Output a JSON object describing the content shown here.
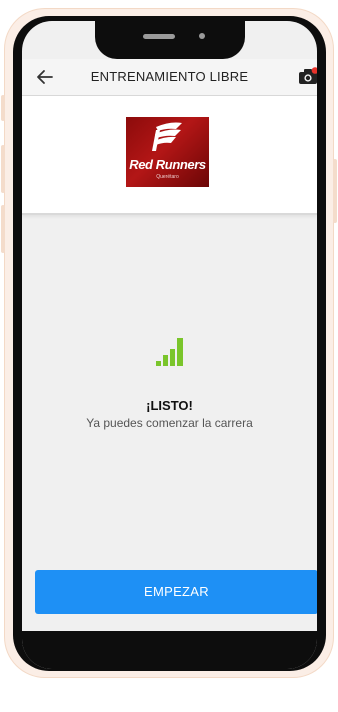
{
  "header": {
    "title": "ENTRENAMIENTO LIBRE",
    "back_icon": "arrow-left-icon",
    "right_icon": "camera-icon"
  },
  "logo": {
    "brand_text": "Red Runners",
    "tagline": "Querétaro"
  },
  "status": {
    "icon": "signal-strength-icon",
    "title": "¡LISTO!",
    "subtitle": "Ya puedes comenzar la carrera"
  },
  "actions": {
    "start_label": "EMPEZAR"
  },
  "colors": {
    "accent": "#1e90f5",
    "signal": "#7ac52b",
    "logo_red": "#b31616",
    "notification_dot": "#e8332b"
  }
}
